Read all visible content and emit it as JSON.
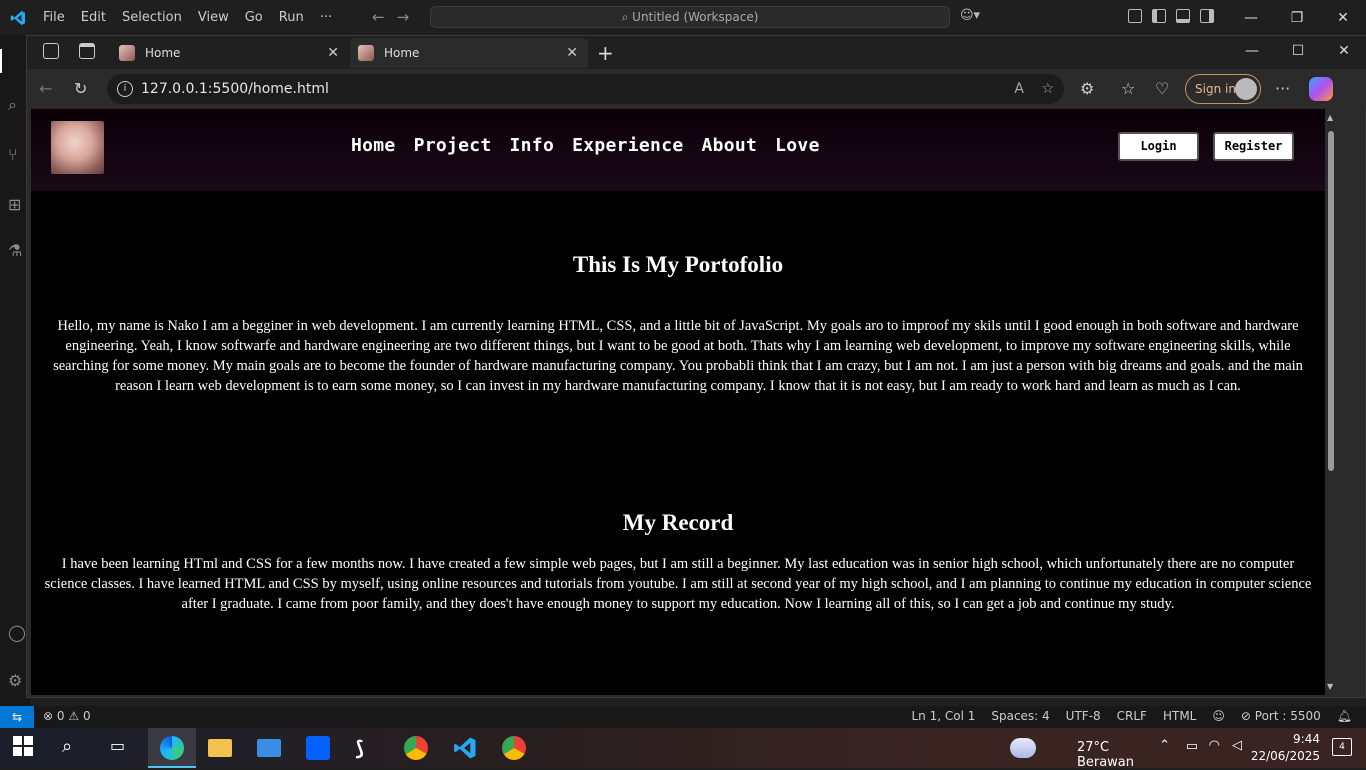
{
  "vscode": {
    "menus": [
      "File",
      "Edit",
      "Selection",
      "View",
      "Go",
      "Run",
      "···"
    ],
    "search_text": "Untitled (Workspace)",
    "status": {
      "errors": "0",
      "warnings": "0",
      "position": "Ln 1, Col 1",
      "spaces": "Spaces: 4",
      "encoding": "UTF-8",
      "eol": "CRLF",
      "language": "HTML",
      "port": "Port : 5500"
    }
  },
  "browser": {
    "tabs": [
      {
        "title": "Home",
        "active": false
      },
      {
        "title": "Home",
        "active": true
      }
    ],
    "url": "127.0.0.1:5500/home.html",
    "signin_label": "Sign in"
  },
  "site": {
    "nav": [
      "Home",
      "Project",
      "Info",
      "Experience",
      "About",
      "Love"
    ],
    "login_label": "Login",
    "register_label": "Register",
    "portfolio_title": "This Is My Portofolio",
    "portfolio_text": "Hello, my name is Nako I am a begginer in web development. I am currently learning HTML, CSS, and a little bit of JavaScript. My goals aro to improof my skils until I good enough in both software and hardware engineering. Yeah, I know softwarfe and hardware engineering are two different things, but I want to be good at both. Thats why I am learning web development, to improve my software engineering skills, while searching for some money. My main goals are to become the founder of hardware manufacturing company. You probabli think that I am crazy, but I am not. I am just a person with big dreams and goals. and the main reason I learn web development is to earn some money, so I can invest in my hardware manufacturing company. I know that it is not easy, but I am ready to work hard and learn as much as I can.",
    "record_title": "My Record",
    "record_text": "I have been learning HTml and CSS for a few months now. I have created a few simple web pages, but I am still a beginner. My last education was in senior high school, which unfortunately there are no computer science classes. I have learned HTML and CSS by myself, using online resources and tutorials from youtube. I am still at second year of my high school, and I am planning to continue my education in computer science after I graduate. I came from poor family, and they does't have enough money to support my education. Now I learning all of this, so I can get a job and continue my study."
  },
  "taskbar": {
    "weather": "27°C Berawan",
    "time": "9:44",
    "date": "22/06/2025",
    "notifications": "4"
  },
  "colors": {
    "vscode_accent": "#0078d4",
    "signin_accent": "#c9955a"
  }
}
